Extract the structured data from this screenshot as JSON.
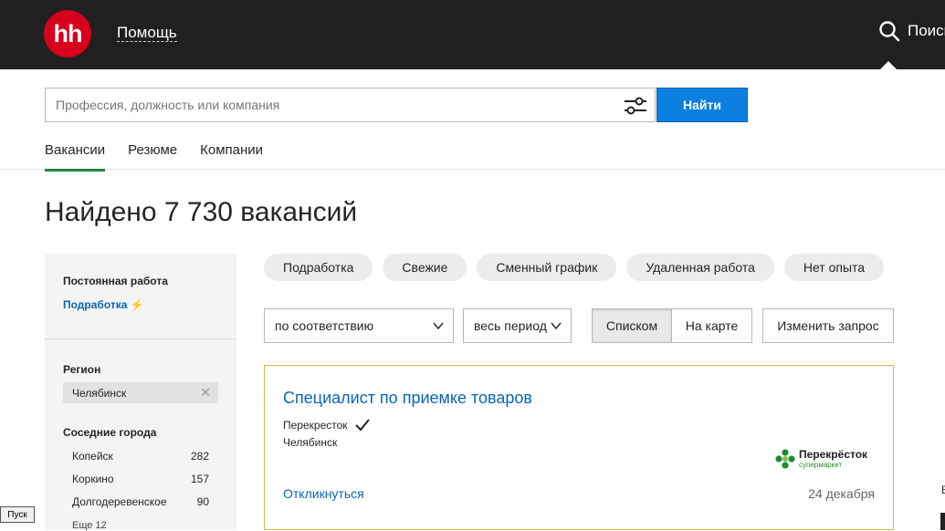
{
  "header": {
    "logo_text": "hh",
    "help_label": "Помощь",
    "search_label": "Поиск"
  },
  "search": {
    "placeholder": "Профессия, должность или компания",
    "find_label": "Найти"
  },
  "tabs": [
    {
      "label": "Вакансии",
      "active": true
    },
    {
      "label": "Резюме",
      "active": false
    },
    {
      "label": "Компании",
      "active": false
    }
  ],
  "main": {
    "title": "Найдено 7 730 вакансий"
  },
  "sidebar": {
    "employment_head": "Постоянная работа",
    "parttime_link": "Подработка",
    "parttime_icon": "⚡",
    "region_head": "Регион",
    "region_value": "Челябинск",
    "nearby_head": "Соседние города",
    "cities": [
      {
        "name": "Копейск",
        "count": "282"
      },
      {
        "name": "Коркино",
        "count": "157"
      },
      {
        "name": "Долгодеревенское",
        "count": "90"
      }
    ],
    "more": "Еще 12"
  },
  "chips": [
    "Подработка",
    "Свежие",
    "Сменный график",
    "Удаленная работа",
    "Нет опыта"
  ],
  "controls": {
    "sort_value": "по соответствию",
    "period_value": "весь период",
    "list_label": "Списком",
    "map_label": "На карте",
    "edit_label": "Изменить запрос"
  },
  "vacancy": {
    "title": "Специалист по приемке товаров",
    "employer": "Перекресток",
    "city": "Челябинск",
    "respond": "Откликнуться",
    "date": "24 декабря",
    "brand_name": "Перекрёсток",
    "brand_sub": "супермаркет"
  },
  "taskbar": {
    "start": "Пуск",
    "edge_text": "Е"
  },
  "colors": {
    "accent_blue": "#0d7fe0",
    "link_blue": "#0a66b5",
    "brand_red": "#d6001c",
    "active_tab": "#27863a"
  }
}
